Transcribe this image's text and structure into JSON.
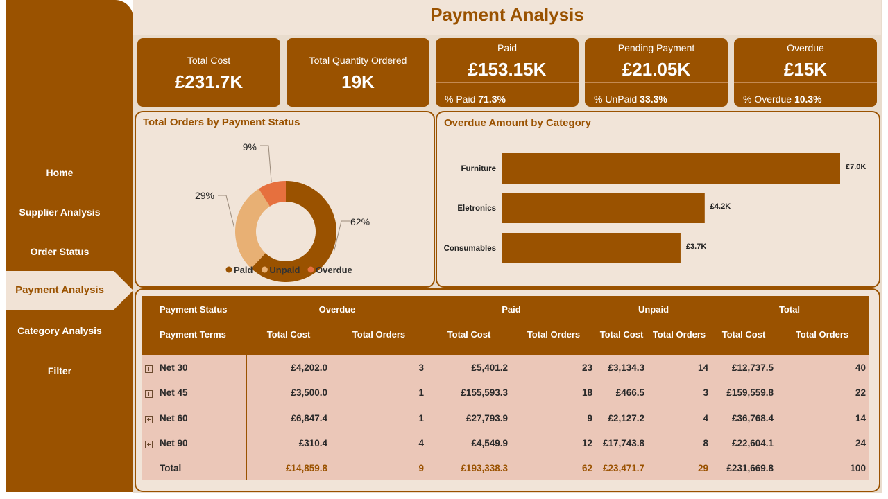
{
  "page_title": "Payment Analysis",
  "nav": {
    "items": [
      "Home",
      "Supplier Analysis",
      "Order Status",
      "Payment Analysis",
      "Category Analysis",
      "Filter"
    ],
    "active": "Payment Analysis"
  },
  "kpis": {
    "total_cost": {
      "label": "Total Cost",
      "value": "£231.7K"
    },
    "total_quantity": {
      "label": "Total Quantity Ordered",
      "value": "19K"
    },
    "paid": {
      "label": "Paid",
      "value": "£153.15K",
      "foot_label": "% Paid",
      "foot_value": "71.3%"
    },
    "pending": {
      "label": "Pending Payment",
      "value": "£21.05K",
      "foot_label": "% UnPaid",
      "foot_value": "33.3%"
    },
    "overdue": {
      "label": "Overdue",
      "value": "£15K",
      "foot_label": "% Overdue",
      "foot_value": "10.3%"
    }
  },
  "colors": {
    "brand": "#9a5200",
    "panel_bg": "#f1e4d8",
    "paid": "#9a5200",
    "unpaid": "#e8b074",
    "overdue": "#e6703e",
    "table_body": "#ebc7b8"
  },
  "chart_data": [
    {
      "type": "pie",
      "title": "Total Orders by Payment Status",
      "categories": [
        "Paid",
        "Unpaid",
        "Overdue"
      ],
      "values": [
        62,
        29,
        9
      ],
      "labels": [
        "62%",
        "29%",
        "9%"
      ],
      "donut": true,
      "legend": "bottom",
      "colors": [
        "#9a5200",
        "#e8b074",
        "#e6703e"
      ]
    },
    {
      "type": "bar",
      "orientation": "horizontal",
      "title": "Overdue Amount by Category",
      "categories": [
        "Furniture",
        "Eletronics",
        "Consumables"
      ],
      "values": [
        7.0,
        4.2,
        3.7
      ],
      "labels": [
        "£7.0K",
        "£4.2K",
        "£3.7K"
      ],
      "xlim": [
        0,
        7.0
      ],
      "color": "#9a5200"
    }
  ],
  "table": {
    "header_row1": {
      "row_label": "Payment Status",
      "groups": [
        "Overdue",
        "Paid",
        "Unpaid",
        "Total"
      ]
    },
    "header_row2": {
      "row_label": "Payment Terms",
      "cols": [
        "Total Cost",
        "Total Orders",
        "Total Cost",
        "Total Orders",
        "Total Cost",
        "Total Orders",
        "Total Cost",
        "Total Orders"
      ]
    },
    "rows": [
      {
        "term": "Net 30",
        "cells": [
          "£4,202.0",
          "3",
          "£5,401.2",
          "23",
          "£3,134.3",
          "14",
          "£12,737.5",
          "40"
        ]
      },
      {
        "term": "Net 45",
        "cells": [
          "£3,500.0",
          "1",
          "£155,593.3",
          "18",
          "£466.5",
          "3",
          "£159,559.8",
          "22"
        ]
      },
      {
        "term": "Net 60",
        "cells": [
          "£6,847.4",
          "1",
          "£27,793.9",
          "9",
          "£2,127.2",
          "4",
          "£36,768.4",
          "14"
        ]
      },
      {
        "term": "Net 90",
        "cells": [
          "£310.4",
          "4",
          "£4,549.9",
          "12",
          "£17,743.8",
          "8",
          "£22,604.1",
          "24"
        ]
      }
    ],
    "total_row": {
      "term": "Total",
      "cells": [
        "£14,859.8",
        "9",
        "£193,338.3",
        "62",
        "£23,471.7",
        "29",
        "£231,669.8",
        "100"
      ]
    }
  }
}
